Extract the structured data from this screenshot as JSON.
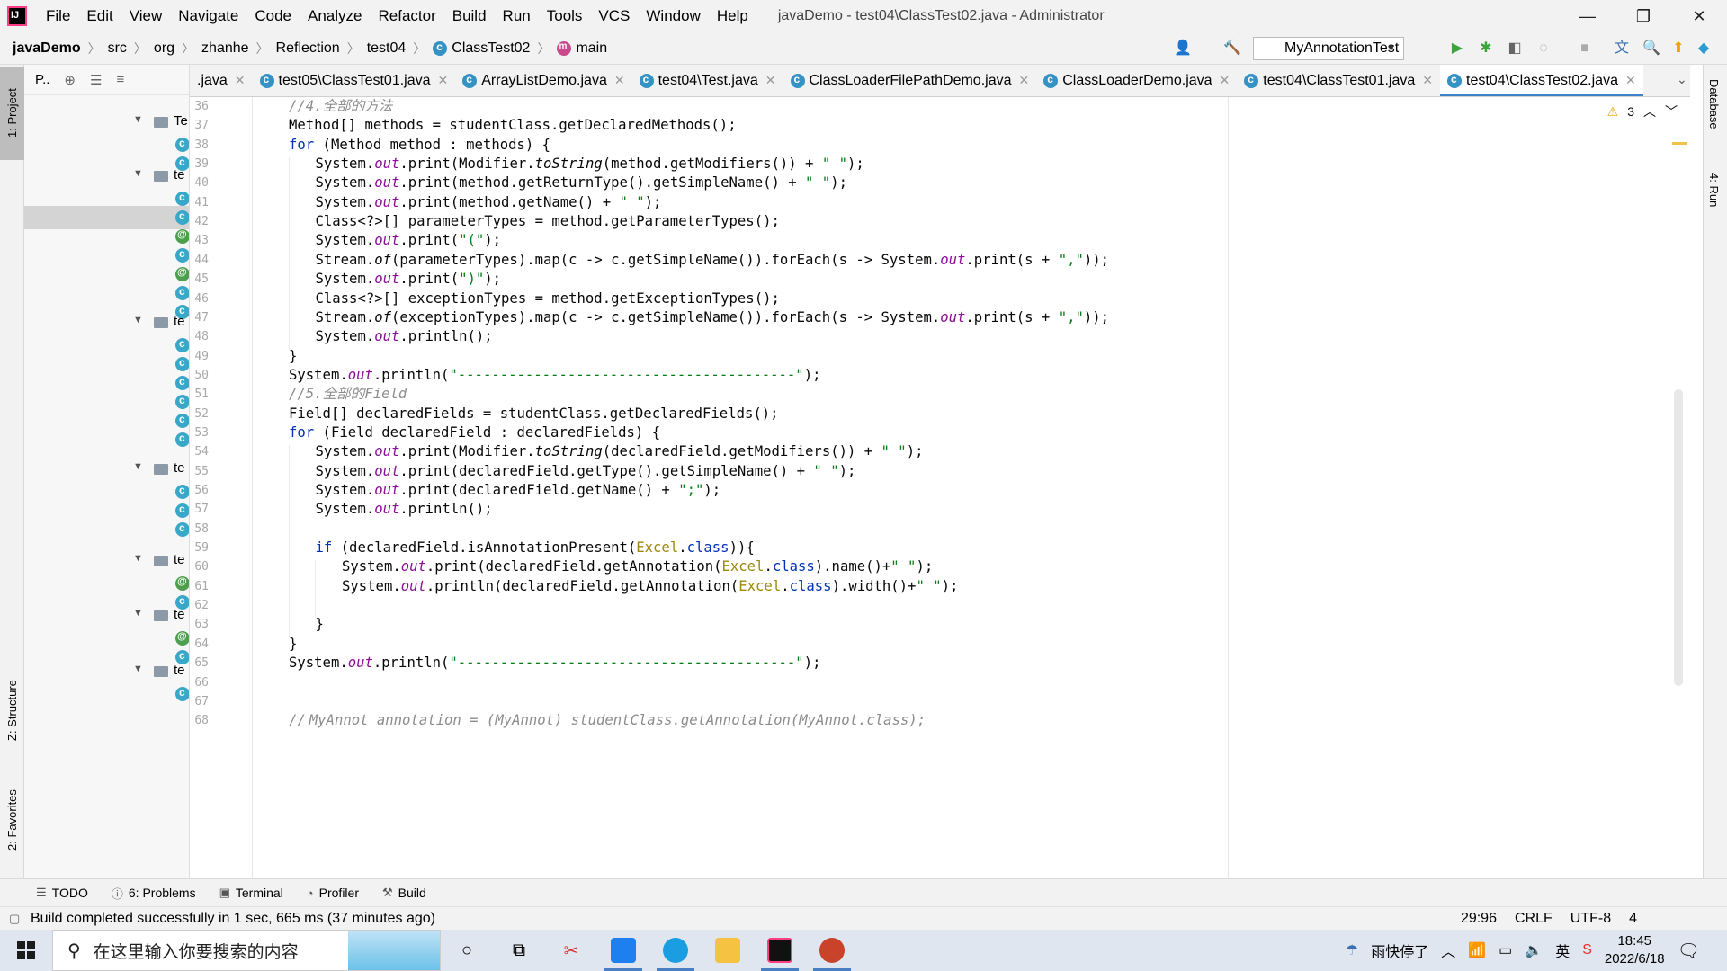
{
  "menu": {
    "items": [
      "File",
      "Edit",
      "View",
      "Navigate",
      "Code",
      "Analyze",
      "Refactor",
      "Build",
      "Run",
      "Tools",
      "VCS",
      "Window",
      "Help"
    ],
    "window_title": "javaDemo - test04\\ClassTest02.java - Administrator",
    "min": "—",
    "max": "❐",
    "close": "✕"
  },
  "nav": {
    "crumbs": [
      "javaDemo",
      "src",
      "org",
      "zhanhe",
      "Reflection",
      "test04",
      "ClassTest02",
      "main"
    ],
    "run_config": "MyAnnotationTest"
  },
  "left_tabs": {
    "project": "1: Project",
    "structure": "Z: Structure",
    "favorites": "2: Favorites"
  },
  "right_tabs": {
    "database": "Database",
    "run": "4: Run"
  },
  "project_panel": {
    "title": "P..",
    "tree": [
      {
        "type": "folder",
        "label": "Te"
      },
      {
        "type": "folder",
        "label": "te"
      },
      {
        "type": "folder",
        "label": "te"
      },
      {
        "type": "folder",
        "label": "te"
      },
      {
        "type": "folder",
        "label": "te"
      },
      {
        "type": "folder",
        "label": "te"
      },
      {
        "type": "folder",
        "label": "te"
      }
    ]
  },
  "tabs": [
    {
      "label": ".java",
      "active": false
    },
    {
      "label": "test05\\ClassTest01.java",
      "active": false
    },
    {
      "label": "ArrayListDemo.java",
      "active": false
    },
    {
      "label": "test04\\Test.java",
      "active": false
    },
    {
      "label": "ClassLoaderFilePathDemo.java",
      "active": false
    },
    {
      "label": "ClassLoaderDemo.java",
      "active": false
    },
    {
      "label": "test04\\ClassTest01.java",
      "active": false
    },
    {
      "label": "test04\\ClassTest02.java",
      "active": true
    }
  ],
  "editor": {
    "warnings": "3",
    "first_line": 36,
    "line_count": 33,
    "code": [
      {
        "n": 36,
        "indent": 0,
        "html": "<span class='cm'>//4.全部的方法</span>"
      },
      {
        "n": 37,
        "indent": 0,
        "html": "Method[] methods = studentClass.getDeclaredMethods();"
      },
      {
        "n": 38,
        "indent": 0,
        "html": "<span class='kw'>for</span> (Method method : methods) {"
      },
      {
        "n": 39,
        "indent": 1,
        "html": "System.<span class='fi'>out</span>.print(Modifier.<span class='sm'>toString</span>(method.getModifiers()) + <span class='st'>\" \"</span>);"
      },
      {
        "n": 40,
        "indent": 1,
        "html": "System.<span class='fi'>out</span>.print(method.getReturnType().getSimpleName() + <span class='st'>\" \"</span>);"
      },
      {
        "n": 41,
        "indent": 1,
        "html": "System.<span class='fi'>out</span>.print(method.getName() + <span class='st'>\" \"</span>);"
      },
      {
        "n": 42,
        "indent": 1,
        "html": "Class&lt;?&gt;[] parameterTypes = method.getParameterTypes();"
      },
      {
        "n": 43,
        "indent": 1,
        "html": "System.<span class='fi'>out</span>.print(<span class='st'>\"(\"</span>);"
      },
      {
        "n": 44,
        "indent": 1,
        "html": "Stream.<span class='sm'>of</span>(parameterTypes).map(c -&gt; c.getSimpleName()).forEach(s -&gt; System.<span class='fi'>out</span>.print(s + <span class='st'>\",\"</span>));"
      },
      {
        "n": 45,
        "indent": 1,
        "html": "System.<span class='fi'>out</span>.print(<span class='st'>\")\"</span>);"
      },
      {
        "n": 46,
        "indent": 1,
        "html": "Class&lt;?&gt;[] exceptionTypes = method.getExceptionTypes();"
      },
      {
        "n": 47,
        "indent": 1,
        "html": "Stream.<span class='sm'>of</span>(exceptionTypes).map(c -&gt; c.getSimpleName()).forEach(s -&gt; System.<span class='fi'>out</span>.print(s + <span class='st'>\",\"</span>));"
      },
      {
        "n": 48,
        "indent": 1,
        "html": "System.<span class='fi'>out</span>.println();"
      },
      {
        "n": 49,
        "indent": 0,
        "html": "}"
      },
      {
        "n": 50,
        "indent": 0,
        "html": "System.<span class='fi'>out</span>.println(<span class='st'>\"----------------------------------------\"</span>);"
      },
      {
        "n": 51,
        "indent": 0,
        "html": "<span class='cm'>//5.全部的Field</span>"
      },
      {
        "n": 52,
        "indent": 0,
        "html": "Field[] declaredFields = studentClass.getDeclaredFields();"
      },
      {
        "n": 53,
        "indent": 0,
        "html": "<span class='kw'>for</span> (Field declaredField : declaredFields) {"
      },
      {
        "n": 54,
        "indent": 1,
        "html": "System.<span class='fi'>out</span>.print(Modifier.<span class='sm'>toString</span>(declaredField.getModifiers()) + <span class='st'>\" \"</span>);"
      },
      {
        "n": 55,
        "indent": 1,
        "html": "System.<span class='fi'>out</span>.print(declaredField.getType().getSimpleName() + <span class='st'>\" \"</span>);"
      },
      {
        "n": 56,
        "indent": 1,
        "html": "System.<span class='fi'>out</span>.print(declaredField.getName() + <span class='st'>\";\"</span>);"
      },
      {
        "n": 57,
        "indent": 1,
        "html": "System.<span class='fi'>out</span>.println();"
      },
      {
        "n": 58,
        "indent": 1,
        "html": ""
      },
      {
        "n": 59,
        "indent": 1,
        "html": "<span class='kw'>if</span> (declaredField.isAnnotationPresent(<span class='an'>Excel</span>.<span class='kw'>class</span>)){"
      },
      {
        "n": 60,
        "indent": 2,
        "html": "System.<span class='fi'>out</span>.print(declaredField.getAnnotation(<span class='an'>Excel</span>.<span class='kw'>class</span>).name()+<span class='st'>\" \"</span>);"
      },
      {
        "n": 61,
        "indent": 2,
        "html": "System.<span class='fi'>out</span>.println(declaredField.getAnnotation(<span class='an'>Excel</span>.<span class='kw'>class</span>).width()+<span class='st'>\" \"</span>);"
      },
      {
        "n": 62,
        "indent": 2,
        "html": ""
      },
      {
        "n": 63,
        "indent": 1,
        "html": "}"
      },
      {
        "n": 64,
        "indent": 0,
        "html": "}"
      },
      {
        "n": 65,
        "indent": 0,
        "html": "System.<span class='fi'>out</span>.println(<span class='st'>\"----------------------------------------\"</span>);"
      },
      {
        "n": 66,
        "indent": 0,
        "html": ""
      },
      {
        "n": 67,
        "indent": 0,
        "html": ""
      },
      {
        "n": 68,
        "indent": 0,
        "html": "<span class='cm'>//</span>"
      }
    ],
    "line68_comment": "  MyAnnot annotation = (MyAnnot) studentClass.getAnnotation(MyAnnot.class);"
  },
  "bottom_tabs": [
    "TODO",
    "6: Problems",
    "Terminal",
    "Profiler",
    "Build"
  ],
  "status": {
    "message": "Build completed successfully in 1 sec, 665 ms (37 minutes ago)",
    "position": "29:96",
    "line_sep": "CRLF",
    "encoding": "UTF-8",
    "indent": "4"
  },
  "taskbar": {
    "search_placeholder": "在这里输入你要搜索的内容",
    "weather": "雨快停了",
    "time": "18:45",
    "date": "2022/6/18",
    "ime": "英"
  },
  "colors": {
    "accent": "#4083c9",
    "keyword": "#0033b3",
    "string": "#067d17",
    "field": "#871094",
    "comment": "#8c8c8c",
    "annotation": "#9e880d"
  }
}
